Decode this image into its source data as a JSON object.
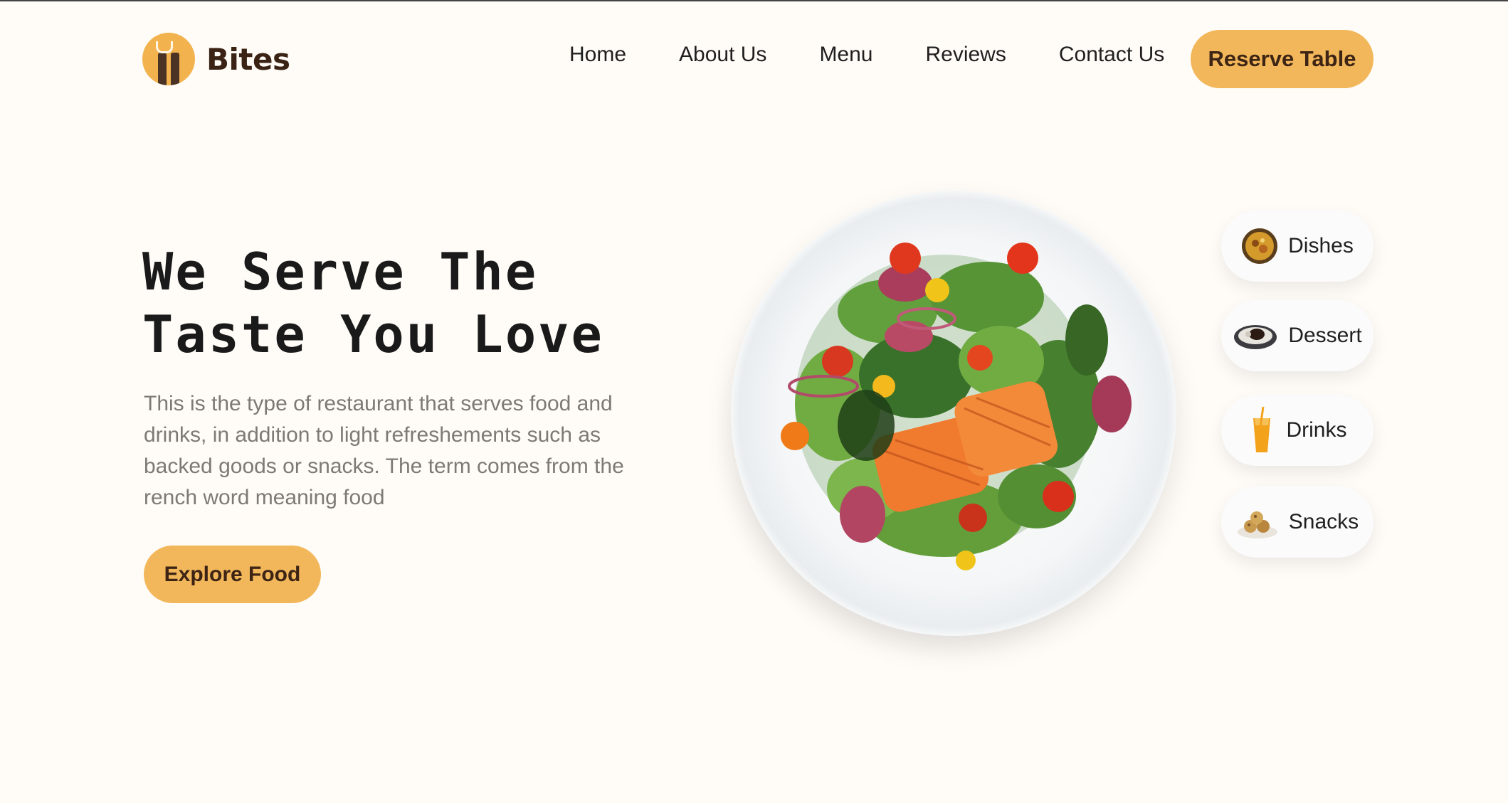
{
  "brand": {
    "name": "Bites",
    "accent": "#f2b75a",
    "text_dark": "#3d2415"
  },
  "nav": {
    "items": [
      {
        "label": "Home"
      },
      {
        "label": "About Us"
      },
      {
        "label": "Menu"
      },
      {
        "label": "Reviews"
      },
      {
        "label": "Contact Us"
      }
    ],
    "cta_label": "Reserve Table"
  },
  "hero": {
    "title_line1": "We Serve The",
    "title_line2": "Taste You Love",
    "description": "This is the type of restaurant that serves food and drinks, in addition to light refreshements such as backed goods or snacks. The term comes from the rench word meaning food",
    "cta_label": "Explore Food",
    "image": "salmon-salad-plate"
  },
  "categories": [
    {
      "label": "Dishes",
      "icon": "dish-icon"
    },
    {
      "label": "Dessert",
      "icon": "dessert-icon"
    },
    {
      "label": "Drinks",
      "icon": "drink-icon"
    },
    {
      "label": "Snacks",
      "icon": "snacks-icon"
    }
  ]
}
